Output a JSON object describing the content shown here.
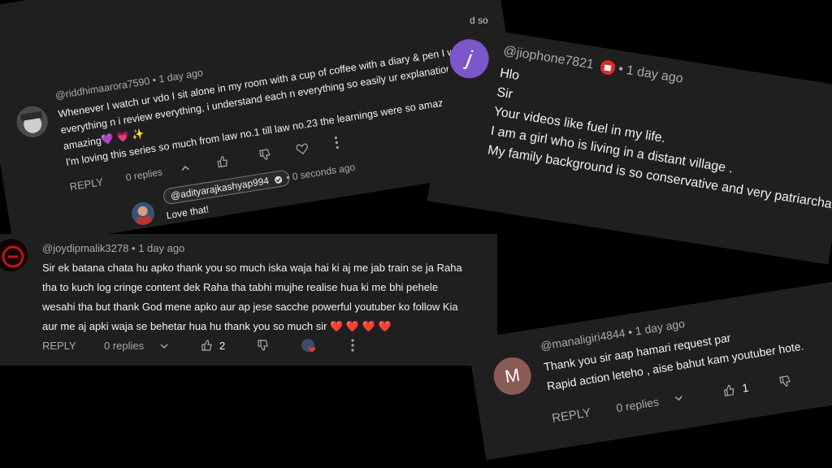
{
  "c1": {
    "handle": "@riddhimaarora7590",
    "time": "1 day ago",
    "lines": [
      "Whenever I watch ur vdo I sit alone in my room with a cup of coffee with a diary & pen I write each n",
      "everything n i review everything, i understand each n everything so easily ur explanation is out of the",
      "amazing💜 💗 ✨",
      "I'm loving this series so much from law no.1 till law no.23 the learnings were so amazing 💪🏼"
    ],
    "reply": "REPLY",
    "replies": "0 replies",
    "sub": {
      "handle": "@adityarajkashyap994",
      "time": "0 seconds ago",
      "text": "Love that!"
    },
    "corner_text": "d so"
  },
  "c2": {
    "handle": "@jiophone7821",
    "time": "1 day ago",
    "avatar_letter": "j",
    "lines": [
      "Hlo",
      "Sir",
      "Your videos like fuel in my life.",
      "I am a girl who is living in a distant village .",
      "My family background is so conservative and very patriarchal."
    ]
  },
  "c3": {
    "handle": "@joydipmalik3278",
    "time": "1 day ago",
    "lines": [
      "Sir ek batana chata hu apko thank you so much iska waja hai ki aj me jab train se ja Raha",
      "tha to kuch log cringe content dek Raha tha tabhi mujhe realise hua ki me bhi pehele",
      "wesahi tha but thank God mene apko aur ap jese sacche powerful youtuber ko follow Kia",
      "aur me aj apki waja se behetar hua hu thank you so much sir ❤️ ❤️ ❤️ ❤️"
    ],
    "reply": "REPLY",
    "replies": "0 replies",
    "likes": "2"
  },
  "c4": {
    "handle": "@manaligiri4844",
    "time": "1 day ago",
    "avatar_letter": "M",
    "lines": [
      "Thank you sir aap hamari request par",
      "Rapid action leteho , aise bahut kam youtuber hote."
    ],
    "reply": "REPLY",
    "replies": "0 replies",
    "likes": "1"
  },
  "colors": {
    "card_bg": "#1f1f1f",
    "muted": "#aaaaaa",
    "text": "#f1f1f1",
    "jio_avatar": "#7b57c9",
    "manali_avatar": "#8a5b55"
  }
}
